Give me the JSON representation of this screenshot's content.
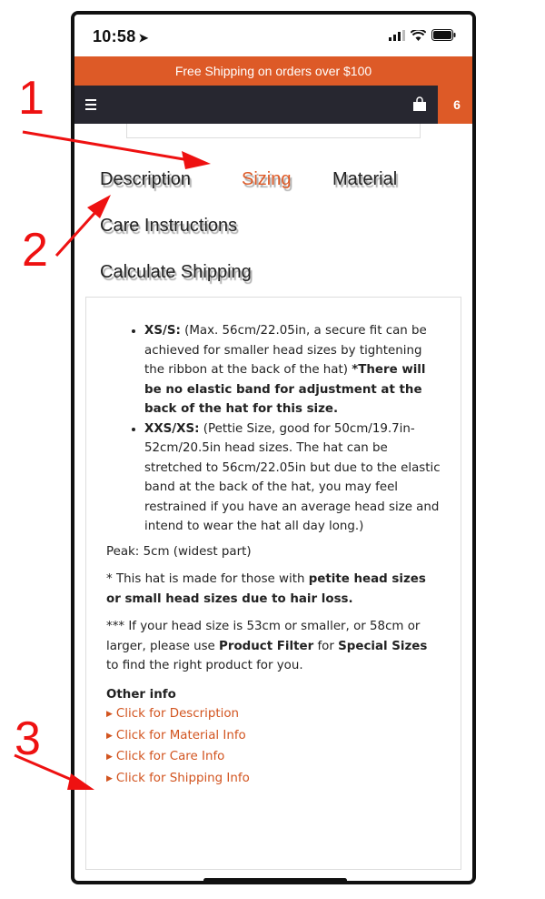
{
  "status_bar": {
    "time": "10:58",
    "location_icon": "location-arrow-icon",
    "signal_icon": "cellular-signal-icon",
    "wifi_icon": "wifi-icon",
    "battery_icon": "battery-icon"
  },
  "promo_banner": {
    "text": "Free Shipping on orders over $100"
  },
  "navbar": {
    "menu_icon": "hamburger-menu-icon",
    "cart_icon": "shopping-bag-icon",
    "cart_count": "6"
  },
  "tabs": [
    {
      "label": "Description",
      "active": false
    },
    {
      "label": "Sizing",
      "active": true
    },
    {
      "label": "Material",
      "active": false
    },
    {
      "label": "Care Instructions",
      "active": false
    },
    {
      "label": "Calculate Shipping",
      "active": false
    }
  ],
  "sizing": {
    "items": [
      {
        "size": "XS/S:",
        "text": " (Max. 56cm/22.05in, a secure fit can be achieved for smaller head sizes by tightening the ribbon at the back of the hat) ",
        "note": "*There will be no elastic band for adjustment at the back of the hat for this size."
      },
      {
        "size": "XXS/XS:",
        "text": " (Pettie Size, good for 50cm/19.7in-52cm/20.5in head sizes. The hat can be stretched to 56cm/22.05in but due to the elastic band at the back of the hat, you may feel restrained if you have an average head size and intend to wear the hat all day long.)"
      }
    ],
    "peak": "Peak: 5cm (widest part)",
    "petite_note_prefix": "* This hat is made for those with ",
    "petite_note_bold": "petite head sizes or small head sizes due to hair loss.",
    "special_prefix": "*** If your head size is 53cm or smaller, or 58cm or larger, please use ",
    "special_filter": "Product Filter",
    "special_for": " for ",
    "special_sizes": "Special Sizes",
    "special_suffix": "  to find the right product for you.",
    "other_info_title": "Other info",
    "links": [
      "Click for Description",
      "Click for Material Info",
      "Click for Care Info",
      "Click for Shipping Info"
    ]
  },
  "annotations": [
    "1",
    "2",
    "3"
  ],
  "colors": {
    "accent": "#dd5a27",
    "navbar": "#272730",
    "annotation": "#ee1111"
  }
}
